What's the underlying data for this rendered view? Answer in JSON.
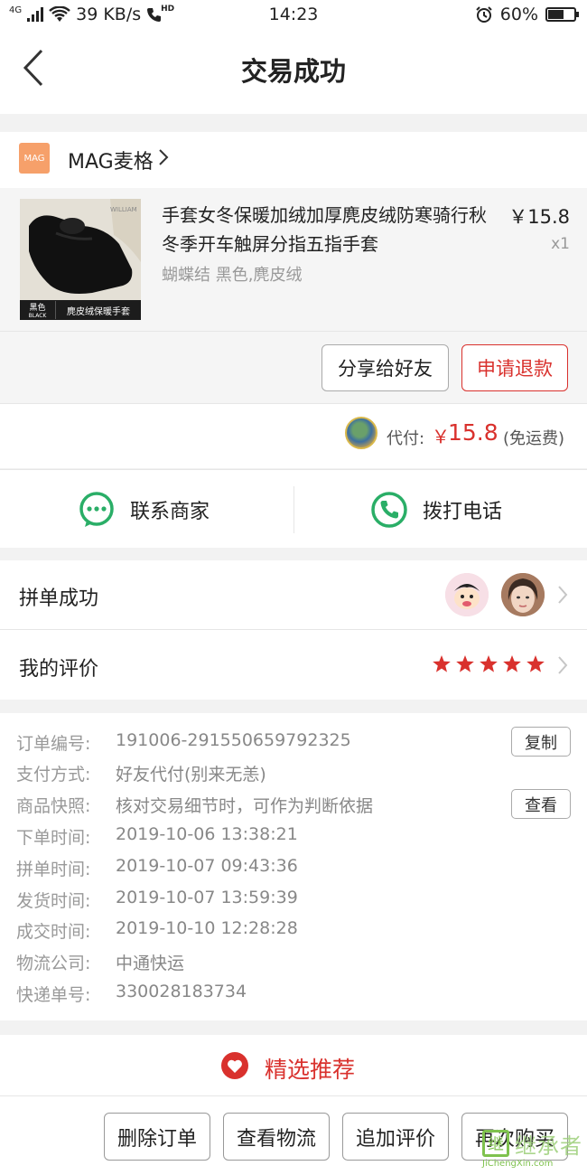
{
  "status_bar": {
    "network": "4G",
    "speed": "39 KB/s",
    "hd_label": "HD",
    "time": "14:23",
    "battery": "60%",
    "battery_level": 0.6
  },
  "navbar": {
    "title": "交易成功"
  },
  "shop": {
    "logo_text": "MAG",
    "name": "MAG麦格"
  },
  "product": {
    "title": "手套女冬保暖加绒加厚麂皮绒防寒骑行秋冬季开车触屏分指五指手套",
    "spec": "蝴蝶结 黑色,麂皮绒",
    "price": "￥15.8",
    "qty": "x1",
    "thumb_caption_color": "黑色",
    "thumb_caption_color_en": "BLACK",
    "thumb_caption_title": "麂皮绒保暖手套",
    "thumb_brand": "WILLIAM",
    "share_label": "分享给好友",
    "refund_label": "申请退款"
  },
  "payment": {
    "label": "代付:",
    "currency": "￥",
    "amount": "15.8",
    "shipping_note": "(免运费)"
  },
  "contact": {
    "merchant_label": "联系商家",
    "phone_label": "拨打电话"
  },
  "group": {
    "success_label": "拼单成功",
    "review_label": "我的评价",
    "rating": 5
  },
  "order_info": {
    "copy_label": "复制",
    "view_label": "查看",
    "rows": [
      {
        "key": "订单编号:",
        "value": "191006-291550659792325"
      },
      {
        "key": "支付方式:",
        "value": "好友代付(别来无恙)"
      },
      {
        "key": "商品快照:",
        "value": "核对交易细节时，可作为判断依据"
      },
      {
        "key": "下单时间:",
        "value": "2019-10-06 13:38:21"
      },
      {
        "key": "拼单时间:",
        "value": "2019-10-07 09:43:36"
      },
      {
        "key": "发货时间:",
        "value": "2019-10-07 13:59:39"
      },
      {
        "key": "成交时间:",
        "value": "2019-10-10 12:28:28"
      },
      {
        "key": "物流公司:",
        "value": "中通快运"
      },
      {
        "key": "快递单号:",
        "value": "330028183734"
      }
    ]
  },
  "recommend": {
    "label": "精选推荐"
  },
  "bottom_bar": {
    "delete_label": "删除订单",
    "logistics_label": "查看物流",
    "add_review_label": "追加评价",
    "rebuy_label": "再次购买"
  },
  "watermark": {
    "text": "继承者",
    "url": "JiChengXin.com",
    "box_char": "继"
  },
  "colors": {
    "accent": "#d9312d",
    "wechat_green": "#2aae67",
    "background": "#f2f2f2"
  }
}
